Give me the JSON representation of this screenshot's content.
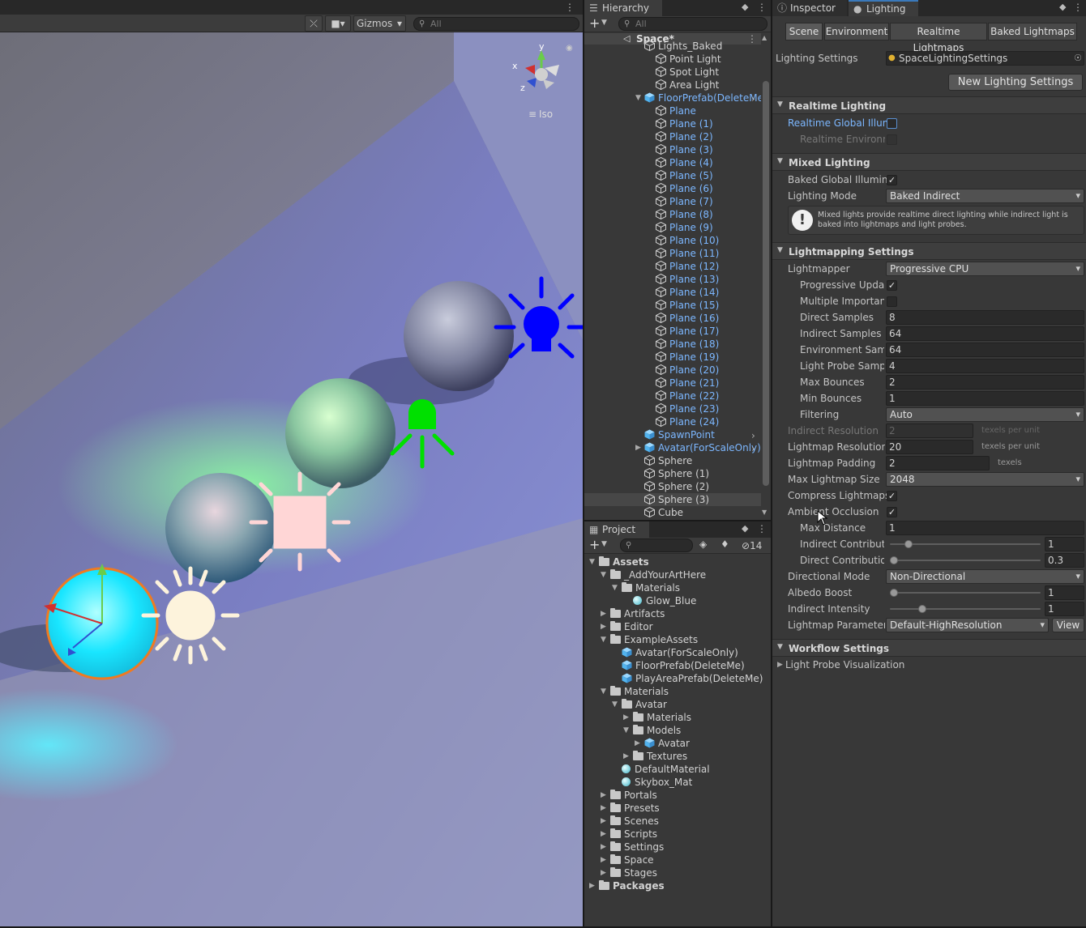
{
  "scene": {
    "gizmos_label": "Gizmos",
    "search_placeholder": "All",
    "projection_label": "Iso",
    "axes": {
      "x": "x",
      "y": "y",
      "z": "z"
    }
  },
  "hierarchy": {
    "tab": "Hierarchy",
    "search_placeholder": "All",
    "root": "Space*",
    "items": [
      {
        "label": "Lights_Baked",
        "blue": false
      },
      {
        "label": "Point Light",
        "blue": false
      },
      {
        "label": "Spot Light",
        "blue": false
      },
      {
        "label": "Area Light",
        "blue": false
      },
      {
        "label": "FloorPrefab(DeleteMe)",
        "blue": true
      },
      {
        "label": "Plane",
        "blue": true
      },
      {
        "label": "Plane (1)",
        "blue": true
      },
      {
        "label": "Plane (2)",
        "blue": true
      },
      {
        "label": "Plane (3)",
        "blue": true
      },
      {
        "label": "Plane (4)",
        "blue": true
      },
      {
        "label": "Plane (5)",
        "blue": true
      },
      {
        "label": "Plane (6)",
        "blue": true
      },
      {
        "label": "Plane (7)",
        "blue": true
      },
      {
        "label": "Plane (8)",
        "blue": true
      },
      {
        "label": "Plane (9)",
        "blue": true
      },
      {
        "label": "Plane (10)",
        "blue": true
      },
      {
        "label": "Plane (11)",
        "blue": true
      },
      {
        "label": "Plane (12)",
        "blue": true
      },
      {
        "label": "Plane (13)",
        "blue": true
      },
      {
        "label": "Plane (14)",
        "blue": true
      },
      {
        "label": "Plane (15)",
        "blue": true
      },
      {
        "label": "Plane (16)",
        "blue": true
      },
      {
        "label": "Plane (17)",
        "blue": true
      },
      {
        "label": "Plane (18)",
        "blue": true
      },
      {
        "label": "Plane (19)",
        "blue": true
      },
      {
        "label": "Plane (20)",
        "blue": true
      },
      {
        "label": "Plane (21)",
        "blue": true
      },
      {
        "label": "Plane (22)",
        "blue": true
      },
      {
        "label": "Plane (23)",
        "blue": true
      },
      {
        "label": "Plane (24)",
        "blue": true
      },
      {
        "label": "SpawnPoint",
        "blue": true
      },
      {
        "label": "Avatar(ForScaleOnly)",
        "blue": true
      },
      {
        "label": "Sphere",
        "blue": false
      },
      {
        "label": "Sphere (1)",
        "blue": false
      },
      {
        "label": "Sphere (2)",
        "blue": false
      },
      {
        "label": "Sphere (3)",
        "blue": false
      },
      {
        "label": "Cube",
        "blue": false
      }
    ]
  },
  "project": {
    "tab": "Project",
    "hidden_count": "14",
    "items": [
      {
        "label": "Assets",
        "type": "folder",
        "bold": true
      },
      {
        "label": "_AddYourArtHere",
        "type": "folder"
      },
      {
        "label": "Materials",
        "type": "folder"
      },
      {
        "label": "Glow_Blue",
        "type": "material"
      },
      {
        "label": "Artifacts",
        "type": "folder"
      },
      {
        "label": "Editor",
        "type": "folder"
      },
      {
        "label": "ExampleAssets",
        "type": "folder"
      },
      {
        "label": "Avatar(ForScaleOnly)",
        "type": "prefab"
      },
      {
        "label": "FloorPrefab(DeleteMe)",
        "type": "prefab"
      },
      {
        "label": "PlayAreaPrefab(DeleteMe)",
        "type": "prefab"
      },
      {
        "label": "Materials",
        "type": "folder"
      },
      {
        "label": "Avatar",
        "type": "folder"
      },
      {
        "label": "Materials",
        "type": "folder"
      },
      {
        "label": "Models",
        "type": "folder"
      },
      {
        "label": "Avatar",
        "type": "prefab"
      },
      {
        "label": "Textures",
        "type": "folder"
      },
      {
        "label": "DefaultMaterial",
        "type": "material"
      },
      {
        "label": "Skybox_Mat",
        "type": "material"
      },
      {
        "label": "Portals",
        "type": "folder"
      },
      {
        "label": "Presets",
        "type": "folder"
      },
      {
        "label": "Scenes",
        "type": "folder"
      },
      {
        "label": "Scripts",
        "type": "folder"
      },
      {
        "label": "Settings",
        "type": "folder"
      },
      {
        "label": "Space",
        "type": "folder"
      },
      {
        "label": "Stages",
        "type": "folder"
      },
      {
        "label": "Packages",
        "type": "folder",
        "bold": true
      }
    ]
  },
  "inspector": {
    "tab_inspector": "Inspector",
    "tab_lighting": "Lighting",
    "subtabs": [
      "Scene",
      "Environment",
      "Realtime Lightmaps",
      "Baked Lightmaps"
    ],
    "lighting_settings_label": "Lighting Settings",
    "lighting_settings_value": "SpaceLightingSettings",
    "new_button": "New Lighting Settings",
    "realtime": {
      "title": "Realtime Lighting",
      "rgi_label": "Realtime Global Illumination",
      "rgi_checked": false,
      "env_label": "Realtime Environment Lighting"
    },
    "mixed": {
      "title": "Mixed Lighting",
      "bgi_label": "Baked Global Illumination",
      "bgi_checked": true,
      "mode_label": "Lighting Mode",
      "mode_value": "Baked Indirect",
      "info": "Mixed lights provide realtime direct lighting while indirect light is baked into lightmaps and light probes."
    },
    "lightmapping": {
      "title": "Lightmapping Settings",
      "lightmapper_label": "Lightmapper",
      "lightmapper_value": "Progressive CPU",
      "progressive_label": "Progressive Updates",
      "progressive_checked": true,
      "mis_label": "Multiple Importance Sampling",
      "mis_checked": false,
      "direct_samples_label": "Direct Samples",
      "direct_samples": "8",
      "indirect_samples_label": "Indirect Samples",
      "indirect_samples": "64",
      "env_samples_label": "Environment Samples",
      "env_samples": "64",
      "probe_samples_label": "Light Probe Sample Multiplier",
      "probe_samples": "4",
      "max_bounces_label": "Max Bounces",
      "max_bounces": "2",
      "min_bounces_label": "Min Bounces",
      "min_bounces": "1",
      "filtering_label": "Filtering",
      "filtering_value": "Auto",
      "indirect_res_label": "Indirect Resolution",
      "indirect_res": "2",
      "texels_per_unit": "texels per unit",
      "lightmap_res_label": "Lightmap Resolution",
      "lightmap_res": "20",
      "padding_label": "Lightmap Padding",
      "padding": "2",
      "texels": "texels",
      "max_size_label": "Max Lightmap Size",
      "max_size": "2048",
      "compress_label": "Compress Lightmaps",
      "compress_checked": true,
      "ao_label": "Ambient Occlusion",
      "ao_checked": true,
      "max_distance_label": "Max Distance",
      "max_distance": "1",
      "indirect_contrib_label": "Indirect Contribution",
      "indirect_contrib": "1",
      "indirect_contrib_fraction": 0.1,
      "direct_contrib_label": "Direct Contribution",
      "direct_contrib": "0.3",
      "direct_contrib_fraction": 0.0,
      "directional_label": "Directional Mode",
      "directional_value": "Non-Directional",
      "albedo_label": "Albedo Boost",
      "albedo": "1",
      "albedo_fraction": 0.0,
      "indirect_intensity_label": "Indirect Intensity",
      "indirect_intensity": "1",
      "indirect_intensity_fraction": 0.2,
      "params_label": "Lightmap Parameters",
      "params_value": "Default-HighResolution",
      "view_button": "View"
    },
    "workflow": {
      "title": "Workflow Settings",
      "probe_vis": "Light Probe Visualization"
    }
  }
}
